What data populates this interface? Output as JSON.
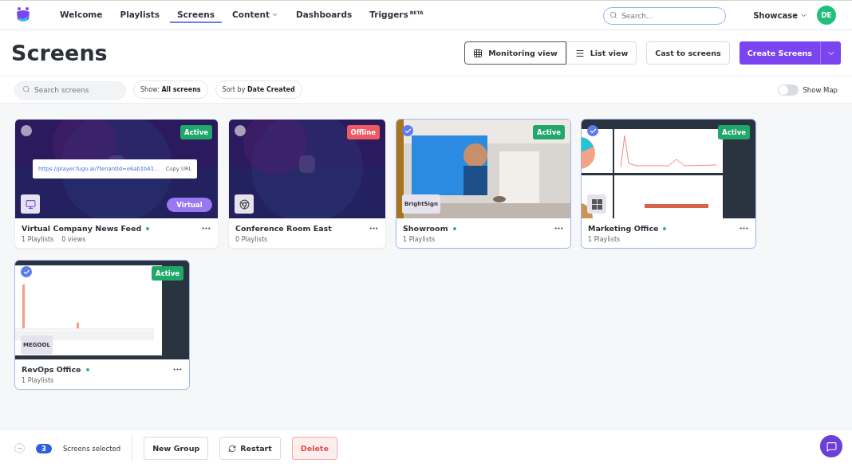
{
  "nav": {
    "items": [
      {
        "label": "Welcome",
        "selected": false
      },
      {
        "label": "Playlists",
        "selected": false
      },
      {
        "label": "Screens",
        "selected": true
      },
      {
        "label": "Content",
        "selected": false,
        "dropdown": true
      },
      {
        "label": "Dashboards",
        "selected": false
      },
      {
        "label": "Triggers",
        "selected": false,
        "badge": "BETA"
      }
    ],
    "search": {
      "placeholder": "Search..."
    },
    "account": "Showcase",
    "avatar": "DE"
  },
  "title": "Screens",
  "view_toggle": [
    {
      "label": "Monitoring view",
      "selected": true,
      "kind": "grid"
    },
    {
      "label": "List view",
      "selected": false,
      "kind": "list"
    }
  ],
  "cast_button": "Cast to screens",
  "create_button": "Create Screens",
  "filters": {
    "search_placeholder": "Search screens",
    "show_label": "Show:",
    "show_value": "All screens",
    "sort_label": "Sort by",
    "sort_value": "Date Created",
    "map_toggle": {
      "label": "Show Map",
      "on": false
    }
  },
  "screens": [
    {
      "name": "Virtual Company News Feed",
      "online": true,
      "playlists": "1 Playlists",
      "views": "0 views",
      "status": "Active",
      "color": "#1fa86a",
      "selected": false,
      "kind": "monitor",
      "virtual_label": "Virtual",
      "url": "https://player.fugo.ai/?tenantId=e6ab1b41...",
      "copy_label": "Copy URL"
    },
    {
      "name": "Conference Room East",
      "online": false,
      "playlists": "0 Playlists",
      "status": "Offline",
      "color": "#ef5a62",
      "selected": false,
      "kind": "chrome"
    },
    {
      "name": "Showroom",
      "online": true,
      "playlists": "1 Playlists",
      "status": "Active",
      "color": "#1fa86a",
      "selected": true,
      "kind": "text",
      "platform_label": "BrightSign"
    },
    {
      "name": "Marketing Office",
      "online": true,
      "playlists": "1 Playlists",
      "status": "Active",
      "color": "#1fa86a",
      "selected": true,
      "kind": "windows"
    },
    {
      "name": "RevOps Office",
      "online": true,
      "playlists": "1 Playlists",
      "status": "Active",
      "color": "#1fa86a",
      "selected": true,
      "kind": "text",
      "platform_label": "MEGOOL"
    }
  ],
  "footer": {
    "partial_selection": true,
    "count": "3",
    "selected_label": "Screens selected",
    "buttons": [
      {
        "label": "New Group",
        "kind": "plain"
      },
      {
        "label": "Restart",
        "kind": "restart"
      },
      {
        "label": "Delete",
        "kind": "danger"
      }
    ]
  }
}
